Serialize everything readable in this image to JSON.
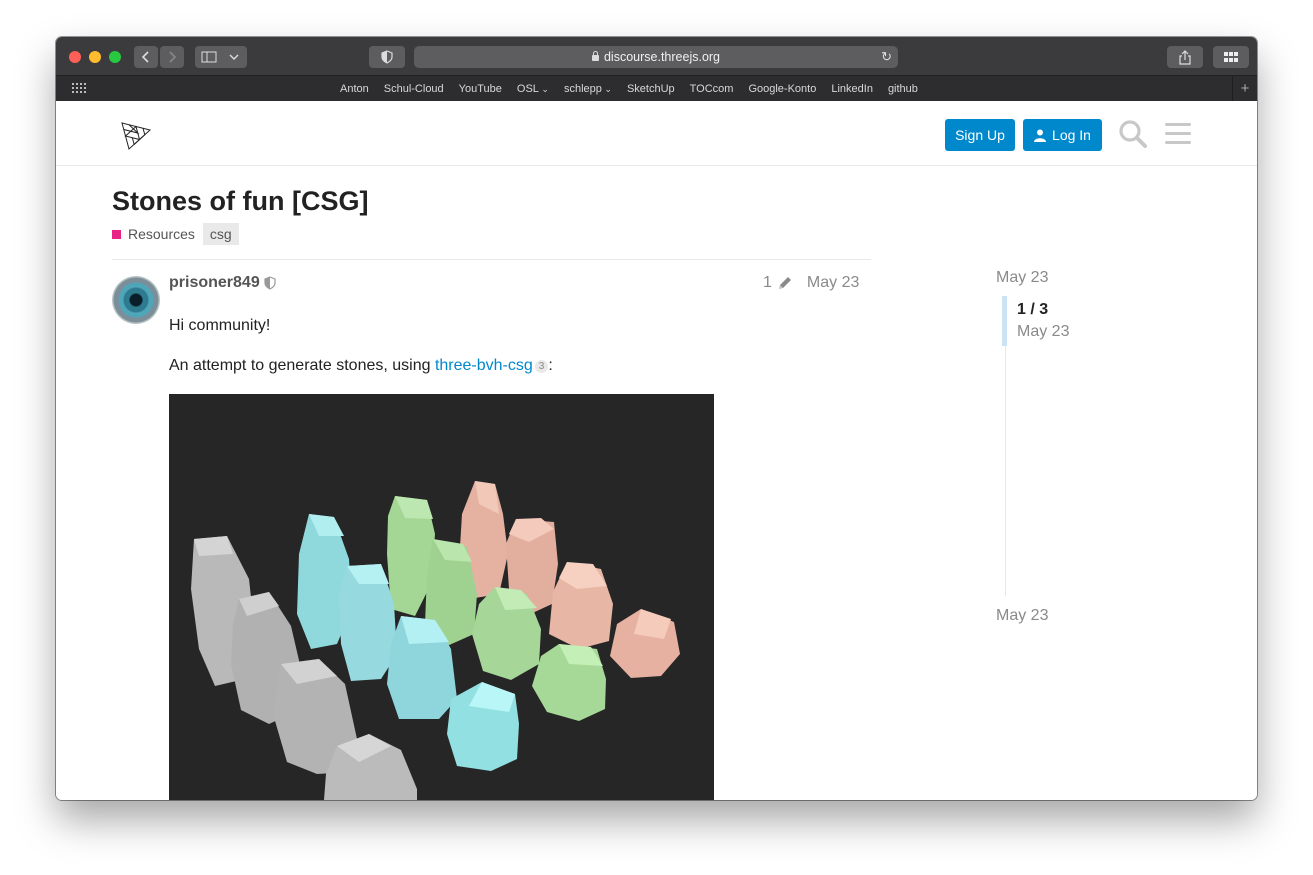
{
  "browser": {
    "url": "discourse.threejs.org",
    "bookmarks": [
      "Anton",
      "Schul-Cloud",
      "YouTube",
      "OSL",
      "schlepp",
      "SketchUp",
      "TOCcom",
      "Google-Konto",
      "LinkedIn",
      "github"
    ]
  },
  "header": {
    "signup_label": "Sign Up",
    "login_label": "Log In"
  },
  "topic": {
    "title": "Stones of fun [CSG]",
    "category": "Resources",
    "category_color": "#e92288",
    "tag": "csg"
  },
  "post": {
    "username": "prisoner849",
    "edit_count": "1",
    "date": "May 23",
    "greeting": "Hi community!",
    "text_before_link": "An attempt to generate stones, using ",
    "link_text": "three-bvh-csg",
    "link_clicks": "3",
    "text_after_link": ":"
  },
  "timeline": {
    "top_date": "May 23",
    "position": "1 / 3",
    "position_date": "May 23",
    "bottom_date": "May 23"
  },
  "colors": {
    "accent": "#0088cc",
    "stone_gray": "#b9b9b9",
    "stone_cyan": "#8fd8dc",
    "stone_green": "#a4d696",
    "stone_pink": "#e5b2a2"
  }
}
